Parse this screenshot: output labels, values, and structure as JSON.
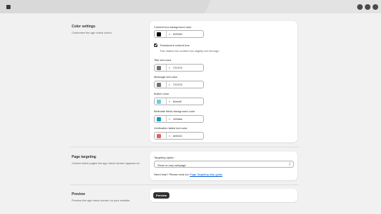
{
  "colors": {
    "accent_dark": "#303030",
    "link": "#005bd3"
  },
  "color_settings": {
    "title": "Color settings",
    "description": "Customize the age check colors.",
    "fields": [
      {
        "label": "Content box background color",
        "hex": "000000",
        "swatch": "#000000"
      },
      {
        "label": "Title text color",
        "hex": "737070",
        "swatch": "#737070"
      },
      {
        "label": "Message text color",
        "hex": "737070",
        "swatch": "#737070"
      },
      {
        "label": "Button color",
        "hex": "6dcbdf",
        "swatch": "#6dcbdf"
      },
      {
        "label": "Birthdate fields background color",
        "hex": "159dba",
        "swatch": "#159dba"
      },
      {
        "label": "Verification failed text color",
        "hex": "de6161",
        "swatch": "#de6161"
      }
    ],
    "hash_symbol": "#",
    "translucent": {
      "label": "Translucent content box",
      "help": "This makes the content box slightly see through.",
      "checked": true
    }
  },
  "page_targeting": {
    "title": "Page targeting",
    "description": "Control which pages the age check screen appears on.",
    "option_label": "Targeting option",
    "option_value": "Show on any webpage",
    "help_prefix": "Need help? Please read our ",
    "help_link": "Page Targeting help guide"
  },
  "preview": {
    "title": "Preview",
    "description": "Preview the age check screen on your website.",
    "button_label": "Preview"
  }
}
